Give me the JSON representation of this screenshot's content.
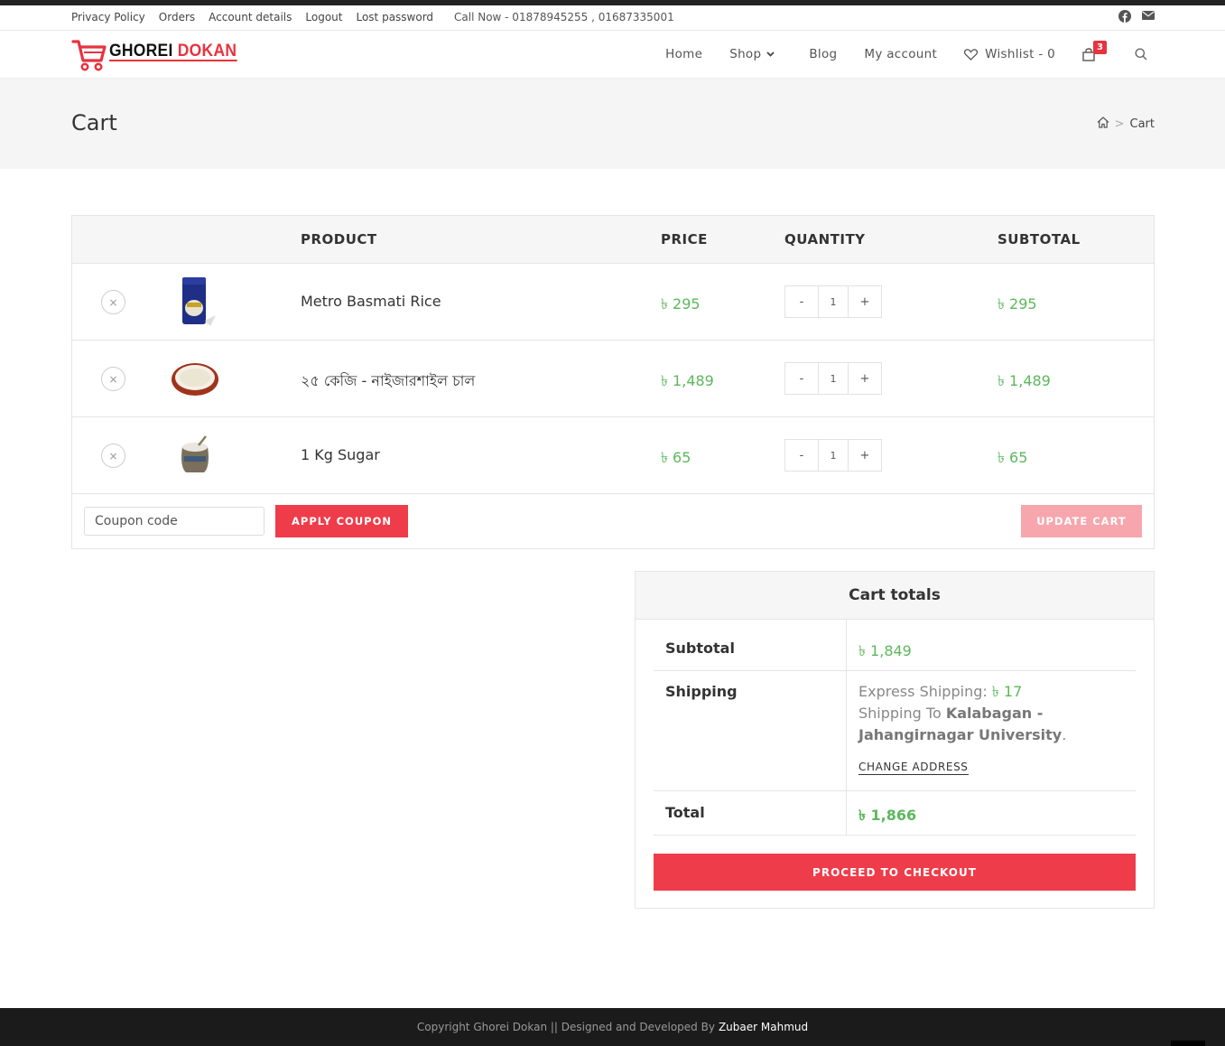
{
  "topbar": {
    "links": [
      "Privacy Policy",
      "Orders",
      "Account details",
      "Logout",
      "Lost password"
    ],
    "call": "Call Now - 01878945255 , 01687335001",
    "social_icons": [
      "facebook-icon",
      "envelope-icon"
    ]
  },
  "header": {
    "logo": {
      "word1": "GHOREI",
      "word2": "DOKAN"
    },
    "nav": {
      "home": "Home",
      "shop": "Shop",
      "blog": "Blog",
      "account": "My account",
      "wishlist": "Wishlist - 0",
      "cart_count": "3"
    }
  },
  "page": {
    "title": "Cart",
    "breadcrumb": "Cart"
  },
  "cart": {
    "headers": {
      "product": "PRODUCT",
      "price": "PRICE",
      "quantity": "QUANTITY",
      "subtotal": "SUBTOTAL"
    },
    "items": [
      {
        "name": "Metro Basmati Rice",
        "price": "৳ 295",
        "qty": "1",
        "subtotal": "৳ 295"
      },
      {
        "name": "২৫ কেজি - নাইজারশাইল চাল",
        "price": "৳ 1,489",
        "qty": "1",
        "subtotal": "৳ 1,489"
      },
      {
        "name": "1 Kg Sugar",
        "price": "৳ 65",
        "qty": "1",
        "subtotal": "৳ 65"
      }
    ],
    "qty_minus": "-",
    "qty_plus": "+",
    "remove_symbol": "×",
    "coupon_placeholder": "Coupon code",
    "apply_coupon": "APPLY COUPON",
    "update_cart": "UPDATE CART"
  },
  "totals": {
    "title": "Cart totals",
    "subtotal_label": "Subtotal",
    "subtotal_value": "৳ 1,849",
    "shipping_label": "Shipping",
    "shipping_method": "Express Shipping:",
    "shipping_cost": "৳ 17",
    "shipping_to_prefix": "Shipping To",
    "shipping_to": "Kalabagan - Jahangirnagar University",
    "change_address": "CHANGE ADDRESS",
    "total_label": "Total",
    "total_value": "৳ 1,866",
    "checkout": "PROCEED TO CHECKOUT"
  },
  "footer": {
    "text": "Copyright Ghorei Dokan || Designed and Developed By",
    "author": "Zubaer Mahmud"
  },
  "colors": {
    "accent": "#ef3c4a",
    "price_green": "#5cb85c",
    "footer_bg": "#1b1b1b"
  }
}
